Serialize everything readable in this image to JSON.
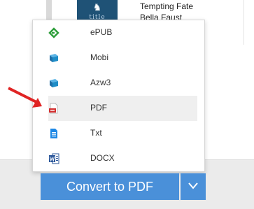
{
  "book": {
    "title": "Tempting Fate",
    "author": "Bella Faust",
    "thumb_text": "title"
  },
  "menu": {
    "items": [
      {
        "label": "ePUB",
        "icon": "epub-icon"
      },
      {
        "label": "Mobi",
        "icon": "mobi-icon"
      },
      {
        "label": "Azw3",
        "icon": "azw3-icon"
      },
      {
        "label": "PDF",
        "icon": "pdf-icon"
      },
      {
        "label": "Txt",
        "icon": "txt-icon"
      },
      {
        "label": "DOCX",
        "icon": "docx-icon"
      }
    ],
    "selected": "PDF"
  },
  "actions": {
    "convert_label": "Convert to PDF",
    "dropdown_icon": "chevron-down-icon"
  },
  "colors": {
    "primary": "#4a90d9",
    "arrow": "#e02424",
    "epub": "#2e9e3b",
    "book": "#1f8dc7",
    "pdf": "#d32f2f",
    "txt": "#1e88e5",
    "docx": "#2b579a"
  }
}
